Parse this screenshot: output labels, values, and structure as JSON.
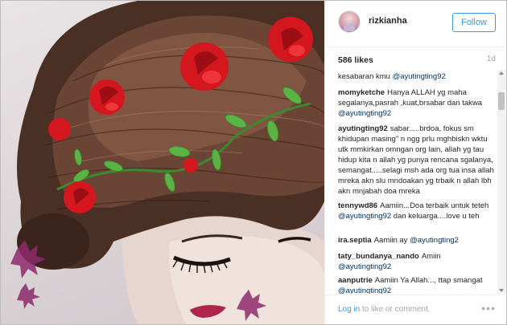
{
  "photo": {
    "subject": "hair-flower-crown-photo"
  },
  "header": {
    "username": "rizkianha",
    "follow_label": "Follow"
  },
  "meta": {
    "likes": "586 likes",
    "age": "1d"
  },
  "comments": [
    {
      "user": "",
      "text": "kesabaran kmu ",
      "mention": "@ayutingting92",
      "after": ""
    },
    {
      "user": "momyketche",
      "text": "Hanya ALLAH yg maha segalanya,pasrah ,kuat,brsabar dan takwa ",
      "mention": "@ayutingting92",
      "after": ""
    },
    {
      "user": "ayutingting92",
      "text": "sabar.....brdoa, fokus sm khidupan masing\" n ngg prlu mghbiskn wktu utk mmkirkan omngan org lain, allah yg tau hidup kita n allah yg punya rencana sgalanya, semangat.....selagi msh ada org tua insa allah mreka akn slu mndoakan yg trbaik n allah lbh akn mnjabah doa mreka",
      "mention": "",
      "after": ""
    },
    {
      "user": "tennywd86",
      "text": "Aamiin...Doa terbaik untuk teteh ",
      "mention": "@ayutingting92",
      "after": " dan keluarga....love u teh"
    },
    {
      "user": "ira.septia",
      "text": "Aamiin ay ",
      "mention": "@ayutingting2",
      "after": ""
    },
    {
      "user": "taty_bundanya_nando",
      "text": "Amiin ",
      "mention": "@ayutingting92",
      "after": ""
    },
    {
      "user": "aanputrie",
      "text": "Aamiin Ya Allah..., ttap smangat ",
      "mention": "@ayutingting92",
      "after": ""
    }
  ],
  "footer": {
    "login_label": "Log in",
    "rest": " to like or comment.",
    "more_icon": "ellipsis-icon"
  },
  "colors": {
    "accent": "#3897f0",
    "mention": "#003569",
    "muted": "#a5a5a5",
    "text": "#262626"
  }
}
